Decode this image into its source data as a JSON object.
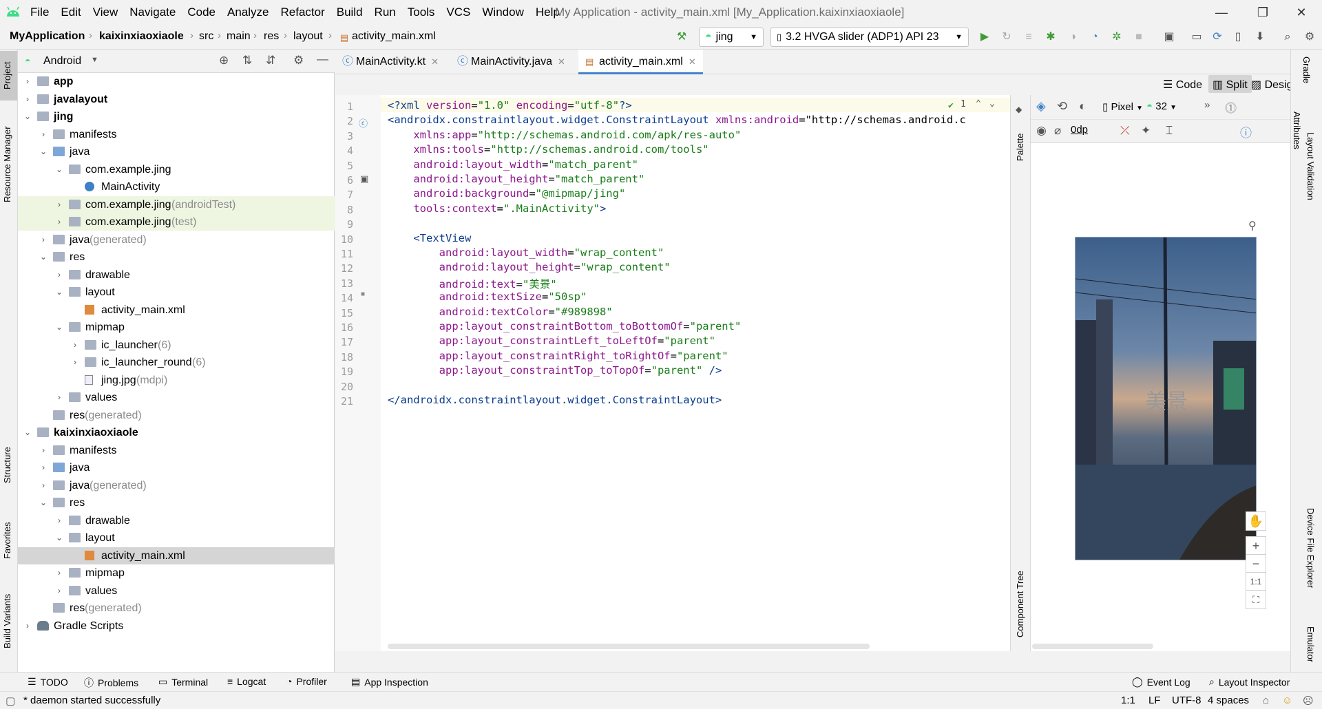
{
  "menubar": {
    "items": [
      "File",
      "Edit",
      "View",
      "Navigate",
      "Code",
      "Analyze",
      "Refactor",
      "Build",
      "Run",
      "Tools",
      "VCS",
      "Window",
      "Help"
    ],
    "window_title": "My Application - activity_main.xml [My_Application.kaixinxiaoxiaole]"
  },
  "breadcrumb": [
    "MyApplication",
    "kaixinxiaoxiaole",
    "src",
    "main",
    "res",
    "layout",
    "activity_main.xml"
  ],
  "toolbar": {
    "run_config": "jing",
    "device": "3.2  HVGA slider (ADP1) API 23"
  },
  "left_strip": [
    "Project",
    "Resource Manager",
    "Structure",
    "Favorites",
    "Build Variants"
  ],
  "project": {
    "view_mode": "Android",
    "tree": [
      {
        "label": "app",
        "extra": "",
        "level": 0,
        "arrow": "›",
        "icon": "folder-module-icon",
        "bold": true
      },
      {
        "label": "javalayout",
        "extra": "",
        "level": 0,
        "arrow": "›",
        "icon": "folder-module-icon",
        "bold": true
      },
      {
        "label": "jing",
        "extra": "",
        "level": 0,
        "arrow": "⌄",
        "icon": "folder-module-icon",
        "bold": true
      },
      {
        "label": "manifests",
        "extra": "",
        "level": 1,
        "arrow": "›",
        "icon": "folder-icon"
      },
      {
        "label": "java",
        "extra": "",
        "level": 1,
        "arrow": "⌄",
        "icon": "folder-blue-icon"
      },
      {
        "label": "com.example.jing",
        "extra": "",
        "level": 2,
        "arrow": "⌄",
        "icon": "package-icon"
      },
      {
        "label": "MainActivity",
        "extra": "",
        "level": 3,
        "arrow": "",
        "icon": "class-icon"
      },
      {
        "label": "com.example.jing",
        "extra": " (androidTest)",
        "level": 2,
        "arrow": "›",
        "icon": "package-icon",
        "hl": true
      },
      {
        "label": "com.example.jing",
        "extra": " (test)",
        "level": 2,
        "arrow": "›",
        "icon": "package-icon",
        "hl": true
      },
      {
        "label": "java",
        "extra": " (generated)",
        "level": 1,
        "arrow": "›",
        "icon": "folder-generated-icon"
      },
      {
        "label": "res",
        "extra": "",
        "level": 1,
        "arrow": "⌄",
        "icon": "folder-res-icon"
      },
      {
        "label": "drawable",
        "extra": "",
        "level": 2,
        "arrow": "›",
        "icon": "folder-icon"
      },
      {
        "label": "layout",
        "extra": "",
        "level": 2,
        "arrow": "⌄",
        "icon": "folder-icon"
      },
      {
        "label": "activity_main.xml",
        "extra": "",
        "level": 3,
        "arrow": "",
        "icon": "xml-layout-icon"
      },
      {
        "label": "mipmap",
        "extra": "",
        "level": 2,
        "arrow": "⌄",
        "icon": "folder-icon"
      },
      {
        "label": "ic_launcher",
        "extra": " (6)",
        "level": 3,
        "arrow": "›",
        "icon": "folder-icon"
      },
      {
        "label": "ic_launcher_round",
        "extra": " (6)",
        "level": 3,
        "arrow": "›",
        "icon": "folder-icon"
      },
      {
        "label": "jing.jpg",
        "extra": " (mdpi)",
        "level": 3,
        "arrow": "",
        "icon": "image-file-icon"
      },
      {
        "label": "values",
        "extra": "",
        "level": 2,
        "arrow": "›",
        "icon": "folder-icon"
      },
      {
        "label": "res",
        "extra": " (generated)",
        "level": 1,
        "arrow": "",
        "icon": "folder-res-icon"
      },
      {
        "label": "kaixinxiaoxiaole",
        "extra": "",
        "level": 0,
        "arrow": "⌄",
        "icon": "folder-module-icon",
        "bold": true
      },
      {
        "label": "manifests",
        "extra": "",
        "level": 1,
        "arrow": "›",
        "icon": "folder-icon"
      },
      {
        "label": "java",
        "extra": "",
        "level": 1,
        "arrow": "›",
        "icon": "folder-blue-icon"
      },
      {
        "label": "java",
        "extra": " (generated)",
        "level": 1,
        "arrow": "›",
        "icon": "folder-generated-icon"
      },
      {
        "label": "res",
        "extra": "",
        "level": 1,
        "arrow": "⌄",
        "icon": "folder-res-icon"
      },
      {
        "label": "drawable",
        "extra": "",
        "level": 2,
        "arrow": "›",
        "icon": "folder-icon"
      },
      {
        "label": "layout",
        "extra": "",
        "level": 2,
        "arrow": "⌄",
        "icon": "folder-icon"
      },
      {
        "label": "activity_main.xml",
        "extra": "",
        "level": 3,
        "arrow": "",
        "icon": "xml-layout-icon",
        "sel": true
      },
      {
        "label": "mipmap",
        "extra": "",
        "level": 2,
        "arrow": "›",
        "icon": "folder-icon"
      },
      {
        "label": "values",
        "extra": "",
        "level": 2,
        "arrow": "›",
        "icon": "folder-icon"
      },
      {
        "label": "res",
        "extra": " (generated)",
        "level": 1,
        "arrow": "",
        "icon": "folder-res-icon"
      },
      {
        "label": "Gradle Scripts",
        "extra": "",
        "level": 0,
        "arrow": "›",
        "icon": "gradle-icon"
      }
    ]
  },
  "editor": {
    "tabs": [
      {
        "label": "MainActivity.kt",
        "icon": "kotlin-file-icon",
        "active": false
      },
      {
        "label": "MainActivity.java",
        "icon": "class-icon",
        "active": false
      },
      {
        "label": "activity_main.xml",
        "icon": "xml-layout-icon",
        "active": true
      }
    ],
    "view_modes": [
      "Code",
      "Split",
      "Design"
    ],
    "inspection_count": "1",
    "lines": [
      "<?xml version=\"1.0\" encoding=\"utf-8\"?>",
      "<androidx.constraintlayout.widget.ConstraintLayout xmlns:android=\"http://schemas.android.c",
      "    xmlns:app=\"http://schemas.android.com/apk/res-auto\"",
      "    xmlns:tools=\"http://schemas.android.com/tools\"",
      "    android:layout_width=\"match_parent\"",
      "    android:layout_height=\"match_parent\"",
      "    android:background=\"@mipmap/jing\"",
      "    tools:context=\".MainActivity\">",
      "",
      "    <TextView",
      "        android:layout_width=\"wrap_content\"",
      "        android:layout_height=\"wrap_content\"",
      "        android:text=\"美景\"",
      "        android:textSize=\"50sp\"",
      "        android:textColor=\"#989898\"",
      "        app:layout_constraintBottom_toBottomOf=\"parent\"",
      "        app:layout_constraintLeft_toLeftOf=\"parent\"",
      "        app:layout_constraintRight_toRightOf=\"parent\"",
      "        app:layout_constraintTop_toTopOf=\"parent\" />",
      "",
      "</androidx.constraintlayout.widget.ConstraintLayout>"
    ]
  },
  "design": {
    "palette_label": "Palette",
    "component_tree_label": "Component Tree",
    "device": "Pixel",
    "api": "32",
    "margin": "0dp",
    "preview_text": "美景",
    "preview_text_color": "#989898",
    "zoom_fit": "1:1"
  },
  "right_strip": [
    "Gradle",
    "Attributes",
    "Layout Validation",
    "Device File Explorer",
    "Emulator"
  ],
  "bottom_tools": [
    "TODO",
    "Problems",
    "Terminal",
    "Logcat",
    "Profiler",
    "App Inspection",
    "Event Log",
    "Layout Inspector"
  ],
  "status": {
    "message": "* daemon started successfully",
    "position": "1:1",
    "line_sep": "LF",
    "encoding": "UTF-8",
    "indent": "4 spaces"
  },
  "colors": {
    "accent": "#4083c9",
    "run_green": "#3f9c35",
    "android_green": "#3ddc84"
  }
}
